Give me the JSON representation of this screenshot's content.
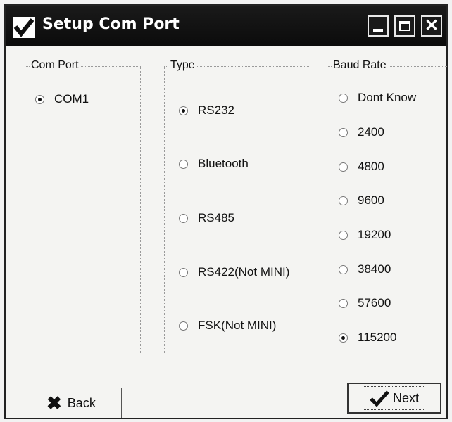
{
  "window": {
    "title": "Setup Com Port",
    "icons": [
      "check-app-icon",
      "minimize-icon",
      "maximize-icon",
      "close-icon"
    ]
  },
  "com_port": {
    "legend": "Com Port",
    "options": [
      {
        "label": "COM1",
        "selected": true
      }
    ]
  },
  "type": {
    "legend": "Type",
    "options": [
      {
        "label": "RS232",
        "selected": true
      },
      {
        "label": "Bluetooth",
        "selected": false
      },
      {
        "label": "RS485",
        "selected": false
      },
      {
        "label": "RS422(Not MINI)",
        "selected": false
      },
      {
        "label": "FSK(Not MINI)",
        "selected": false
      }
    ]
  },
  "baud_rate": {
    "legend": "Baud Rate",
    "options": [
      {
        "label": "Dont Know",
        "selected": false
      },
      {
        "label": "2400",
        "selected": false
      },
      {
        "label": "4800",
        "selected": false
      },
      {
        "label": "9600",
        "selected": false
      },
      {
        "label": "19200",
        "selected": false
      },
      {
        "label": "38400",
        "selected": false
      },
      {
        "label": "57600",
        "selected": false
      },
      {
        "label": "115200",
        "selected": true
      }
    ]
  },
  "buttons": {
    "back": "Back",
    "next": "Next"
  }
}
